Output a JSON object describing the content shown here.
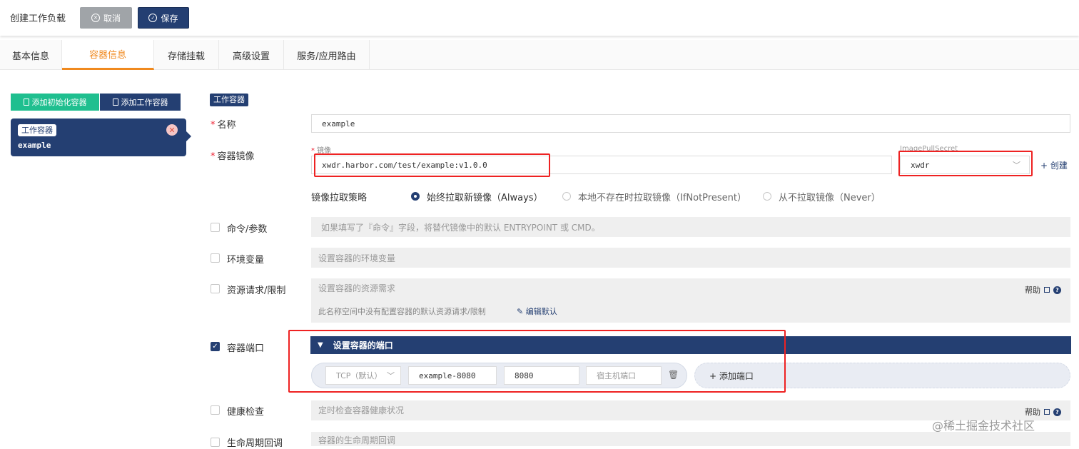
{
  "header": {
    "title": "创建工作负载",
    "cancel_label": "取消",
    "save_label": "保存"
  },
  "tabs": [
    {
      "label": "基本信息"
    },
    {
      "label": "容器信息"
    },
    {
      "label": "存储挂载"
    },
    {
      "label": "高级设置"
    },
    {
      "label": "服务/应用路由"
    }
  ],
  "left": {
    "add_init_label": "添加初始化容器",
    "add_work_label": "添加工作容器",
    "card_tag": "工作容器",
    "card_name": "example"
  },
  "form": {
    "section_badge": "工作容器",
    "name_label": "名称",
    "name_value": "example",
    "image_label": "容器镜像",
    "image_sub_label": "镜像",
    "image_value": "xwdr.harbor.com/test/example:v1.0.0",
    "secret_label": "ImagePullSecret",
    "secret_value": "xwdr",
    "create_label": "+ 创建",
    "pull_policy_label": "镜像拉取策略",
    "pull_options": [
      {
        "label": "始终拉取新镜像（Always）",
        "selected": true
      },
      {
        "label": "本地不存在时拉取镜像（IfNotPresent）",
        "selected": false
      },
      {
        "label": "从不拉取镜像（Never）",
        "selected": false
      }
    ],
    "command_label": "命令/参数",
    "command_hint": "如果填写了『命令』字段，将替代镜像中的默认 ENTRYPOINT 或 CMD。",
    "env_label": "环境变量",
    "env_hint": "设置容器的环境变量",
    "resource_label": "资源请求/限制",
    "resource_hint": "设置容器的资源需求",
    "resource_note": "此名称空间中没有配置容器的默认资源请求/限制",
    "edit_default_label": "编辑默认",
    "help_label": "帮助",
    "ports_label": "容器端口",
    "ports_checked": true,
    "ports_header": "设置容器的端口",
    "port_protocol": "TCP（默认）",
    "port_name": "example-8080",
    "port_container": "8080",
    "port_host_placeholder": "宿主机端口",
    "add_port_label": "+ 添加端口",
    "health_label": "健康检查",
    "health_hint": "定时检查容器健康状况",
    "lifecycle_label": "生命周期回调",
    "lifecycle_hint": "容器的生命周期回调"
  },
  "watermark": "@稀土掘金技术社区",
  "colors": {
    "primary": "#243f72",
    "accent_orange": "#f0891e",
    "init_green": "#1fbf8f",
    "annotation_red": "#e22222"
  },
  "icons": [
    "cancel-circle-icon",
    "save-check-icon",
    "document-icon",
    "close-icon",
    "chevron-down-icon",
    "trash-icon",
    "edit-icon",
    "external-link-icon",
    "help-icon"
  ]
}
